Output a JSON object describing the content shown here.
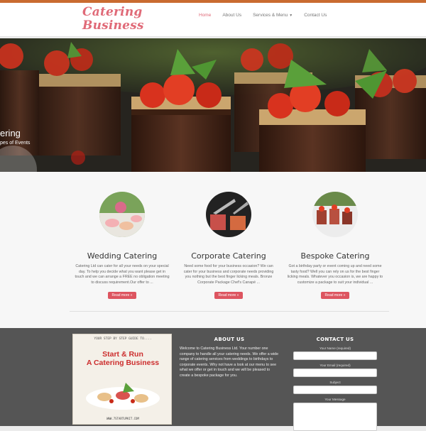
{
  "header": {
    "logo_line1": "Catering",
    "logo_line2": "Business",
    "nav": [
      {
        "label": "Home"
      },
      {
        "label": "About Us"
      },
      {
        "label": "Services & Menu"
      },
      {
        "label": "Contact Us"
      }
    ]
  },
  "hero": {
    "caption_title": "ering",
    "caption_sub": "pes of Events"
  },
  "services": [
    {
      "title": "Wedding Catering",
      "text": "Catering Ltd can cater for all your needs on your special day. To help you decide what you want please get in touch and we can arrange a FREE no obligation meeting to discuss requirement.Our offer to ...",
      "button": "Read more »"
    },
    {
      "title": "Corporate Catering",
      "text": "Need some food for your business occasion? We can cater for your business and corporate needs providing you nothing but the best finger licking meals. Bronze Corporate Package Chef's Canapé ...",
      "button": "Read more »"
    },
    {
      "title": "Bespoke Catering",
      "text": "Got a birthday party or event coming up and need some tasty food? Well you can rely on us for the best finger licking meals. Whatever you occasion is, we are happy to customize a package to suit your individual ...",
      "button": "Read more »"
    }
  ],
  "footer": {
    "book": {
      "kicker": "YOUR STEP BY STEP GUIDE TO....",
      "title_line1": "Start & Run",
      "title_line2": "A Catering Business",
      "url": "WWW.7STARTUPKIT.COM"
    },
    "about_heading": "ABOUT US",
    "about_text": "Welcome to Catering Business Ltd. Your number one company to handle all your catering needs. We offer a wide range of catering services from weddings to birthdays to corporate events. Why not have a look at our menu to see what we offer or get in touch and we will be pleased to create a bespoke package for you.",
    "contact_heading": "CONTACT US",
    "form": {
      "name_label": "Your Name (required)",
      "email_label": "Your Email (required)",
      "subject_label": "Subject",
      "message_label": "Your Message"
    }
  },
  "colors": {
    "brand": "#e06a78",
    "button": "#dd5560",
    "footer_bg": "#555555",
    "cake_chocolate": "#4a2a1c",
    "strawberry": "#d8321e",
    "mint": "#5aa03a"
  }
}
